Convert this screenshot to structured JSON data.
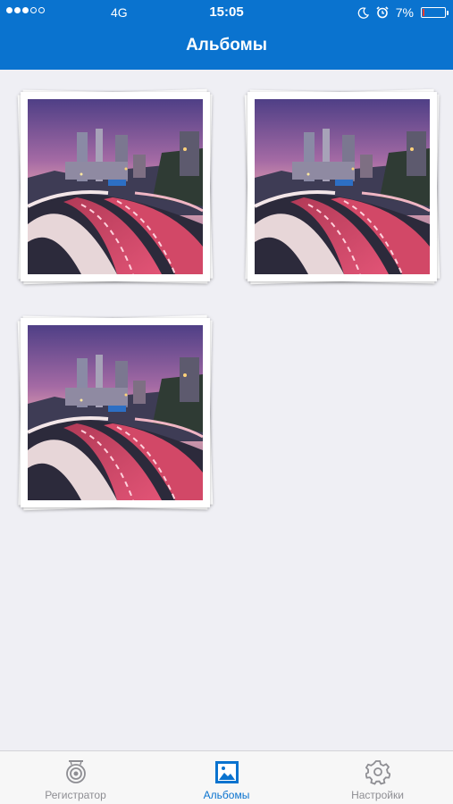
{
  "status_bar": {
    "signal_dots_filled": 3,
    "signal_dots_total": 5,
    "network": "4G",
    "time": "15:05",
    "battery_percent": "7%",
    "battery_level": 0.07,
    "icons": [
      "moon-icon",
      "alarm-icon",
      "battery-icon"
    ]
  },
  "nav": {
    "title": "Альбомы"
  },
  "albums": [
    {
      "icon": "city-highway-photo"
    },
    {
      "icon": "city-highway-photo"
    },
    {
      "icon": "city-highway-photo"
    }
  ],
  "tabbar": {
    "active": "albums",
    "items": [
      {
        "label": "Регистратор",
        "icon": "dashcam-icon"
      },
      {
        "label": "Альбомы",
        "icon": "photo-album-icon"
      },
      {
        "label": "Настройки",
        "icon": "gear-icon"
      }
    ]
  },
  "colors": {
    "accent": "#0a73cf",
    "background": "#efeff4",
    "battery_low": "#ff3b30"
  }
}
